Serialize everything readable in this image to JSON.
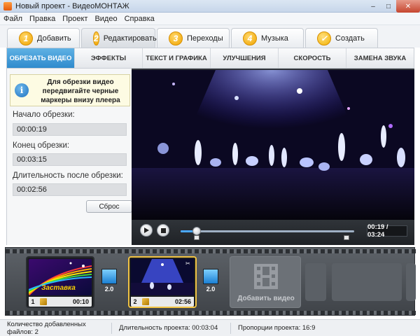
{
  "window": {
    "title": "Новый проект - ВидеоМОНТАЖ",
    "icon": "app-icon"
  },
  "menu": [
    "Файл",
    "Правка",
    "Проект",
    "Видео",
    "Справка"
  ],
  "main_tabs": [
    {
      "num": "1",
      "label": "Добавить",
      "active": false
    },
    {
      "num": "2",
      "label": "Редактировать",
      "active": true
    },
    {
      "num": "3",
      "label": "Переходы",
      "active": false
    },
    {
      "num": "4",
      "label": "Музыка",
      "active": false
    },
    {
      "num": "✓",
      "label": "Создать",
      "active": false
    }
  ],
  "sub_tabs": [
    {
      "label": "ОБРЕЗАТЬ ВИДЕО",
      "active": true
    },
    {
      "label": "ЭФФЕКТЫ",
      "active": false
    },
    {
      "label": "ТЕКСТ И ГРАФИКА",
      "active": false
    },
    {
      "label": "УЛУЧШЕНИЯ",
      "active": false
    },
    {
      "label": "СКОРОСТЬ",
      "active": false
    },
    {
      "label": "ЗАМЕНА ЗВУКА",
      "active": false
    }
  ],
  "trim": {
    "info": "Для обрезки видео передвигайте черные маркеры внизу плеера",
    "start_label": "Начало обрезки:",
    "start_value": "00:00:19",
    "end_label": "Конец обрезки:",
    "end_value": "00:03:15",
    "duration_label": "Длительность после обрезки:",
    "duration_value": "00:02:56",
    "reset_label": "Сброс"
  },
  "player": {
    "time_display": "00:19 / 03:24",
    "progress": 0.093,
    "trim_start": 0.093,
    "trim_end": 0.956
  },
  "timeline": {
    "clips": [
      {
        "num": "1",
        "duration": "00:10",
        "title_text": "Заставка",
        "selected": false
      },
      {
        "num": "2",
        "duration": "02:56",
        "selected": true
      }
    ],
    "transitions": [
      "2.0",
      "2.0"
    ],
    "add_video_label": "Добавить видео"
  },
  "status": {
    "files": "Количество добавленных файлов: 2",
    "duration": "Длительность проекта: 00:03:04",
    "ratio": "Пропорции проекта: 16:9"
  },
  "colors": {
    "accent_blue": "#2f8bcd",
    "selection_gold": "#f1c343",
    "badge": "#f0a400"
  }
}
